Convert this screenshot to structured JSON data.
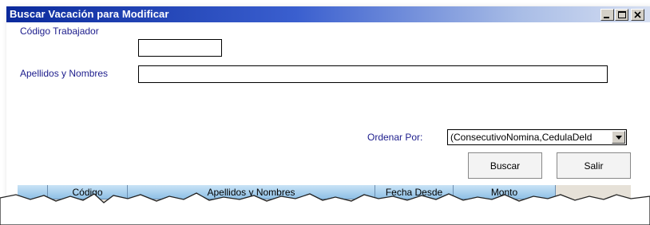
{
  "window": {
    "title": "Buscar Vacación para Modificar",
    "controls": [
      "minimize-icon",
      "maximize-icon",
      "close-icon"
    ]
  },
  "form": {
    "codigo_label": "Código Trabajador",
    "codigo_value": "",
    "nombres_label": "Apellidos y Nombres",
    "nombres_value": "",
    "ordenar_label": "Ordenar Por:",
    "ordenar_value": "(ConsecutivoNomina,CedulaDeld"
  },
  "buttons": {
    "buscar": "Buscar",
    "salir": "Salir"
  },
  "grid": {
    "columns": [
      "",
      "Código",
      "Apellidos y Nombres",
      "Fecha Desde",
      "Monto"
    ]
  },
  "colors": {
    "title_start": "#0b2a9c",
    "label": "#1c1c8c",
    "header": "#8fc0e6"
  }
}
